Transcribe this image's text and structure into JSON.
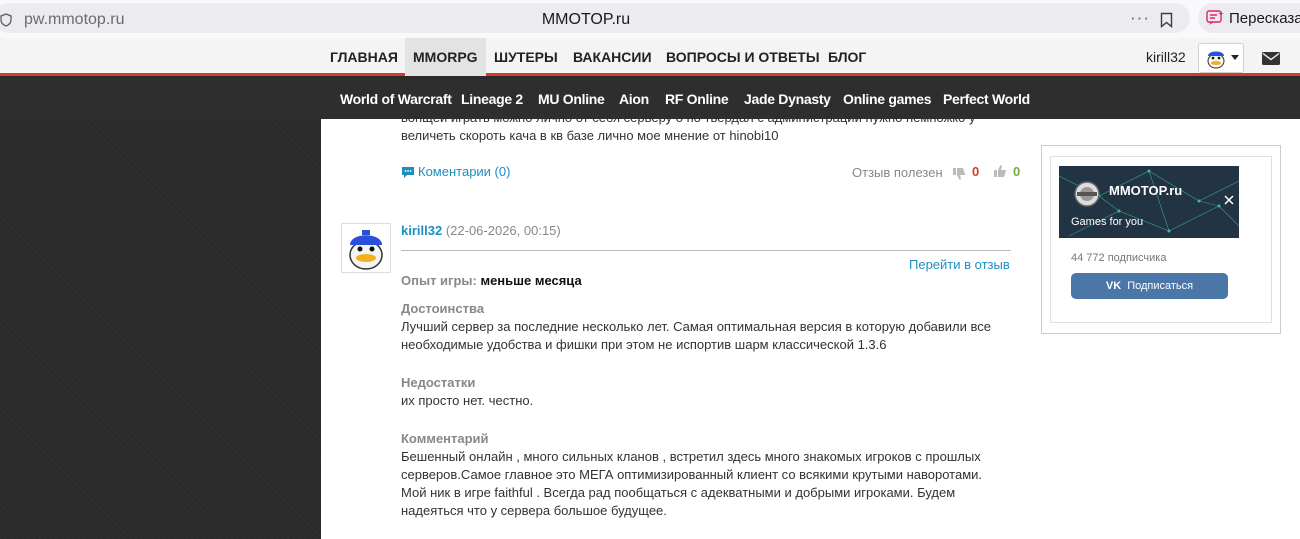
{
  "browser": {
    "url": "pw.mmotop.ru",
    "title": "MMOTOP.ru",
    "dots": "···",
    "retell_label": "Пересказа"
  },
  "main_nav": {
    "items": [
      "ГЛАВНАЯ",
      "MMORPG",
      "ШУТЕРЫ",
      "ВАКАНСИИ",
      "ВОПРОСЫ И ОТВЕТЫ",
      "БЛОГ"
    ],
    "active": "MMORPG",
    "username": "kirill32"
  },
  "game_nav": {
    "items": [
      "World of Warcraft",
      "Lineage 2",
      "MU Online",
      "Aion",
      "RF Online",
      "Jade Dynasty",
      "Online games",
      "Perfect World"
    ]
  },
  "previous_review": {
    "text_line1": "вонщей играть можно лично от себя серверу о по твердал с администрации нужно немножко у",
    "text_line2": "величеть скороть кача в кв базе лично мое мнение от hinobi10",
    "comments_label": "Коментарии (0)",
    "helpful_label": "Отзыв полезен",
    "dislikes": "0",
    "likes": "0"
  },
  "review": {
    "author": "kirill32",
    "date": "(22-06-2026, 00:15)",
    "goto_label": "Перейти в отзыв",
    "experience_label": "Опыт игры:",
    "experience_value": "меньше месяца",
    "pros_title": "Достоинства",
    "pros_text": "Лучший сервер за последние несколько лет. Самая оптимальная версия в которую добавили все необходимые удобства и фишки при этом не испортив шарм классической 1.3.6",
    "cons_title": "Недостатки",
    "cons_text": "их просто нет. честно.",
    "comment_title": "Комментарий",
    "comment_text": "Бешенный онлайн , много сильных кланов , встретил здесь много знакомых игроков с прошлых серверов.Самое главное это МЕГА оптимизированный клиент со всякими крутыми наворотами. Мой ник в игре faithful . Всегда рад пообщаться с адекватными и добрыми игроками. Будем надеяться что у сервера большое будущее."
  },
  "vk_widget": {
    "group_name": "MMOTOP.ru",
    "tagline": "Games for you",
    "subscribers": "44 772 подписчика",
    "subscribe_label": "Подписаться",
    "vk_mark": "VK"
  },
  "colors": {
    "accent_red": "#d53a2a",
    "link_blue": "#1c8fc1",
    "vk_blue": "#4a76a8",
    "like_green": "#79a93a"
  }
}
